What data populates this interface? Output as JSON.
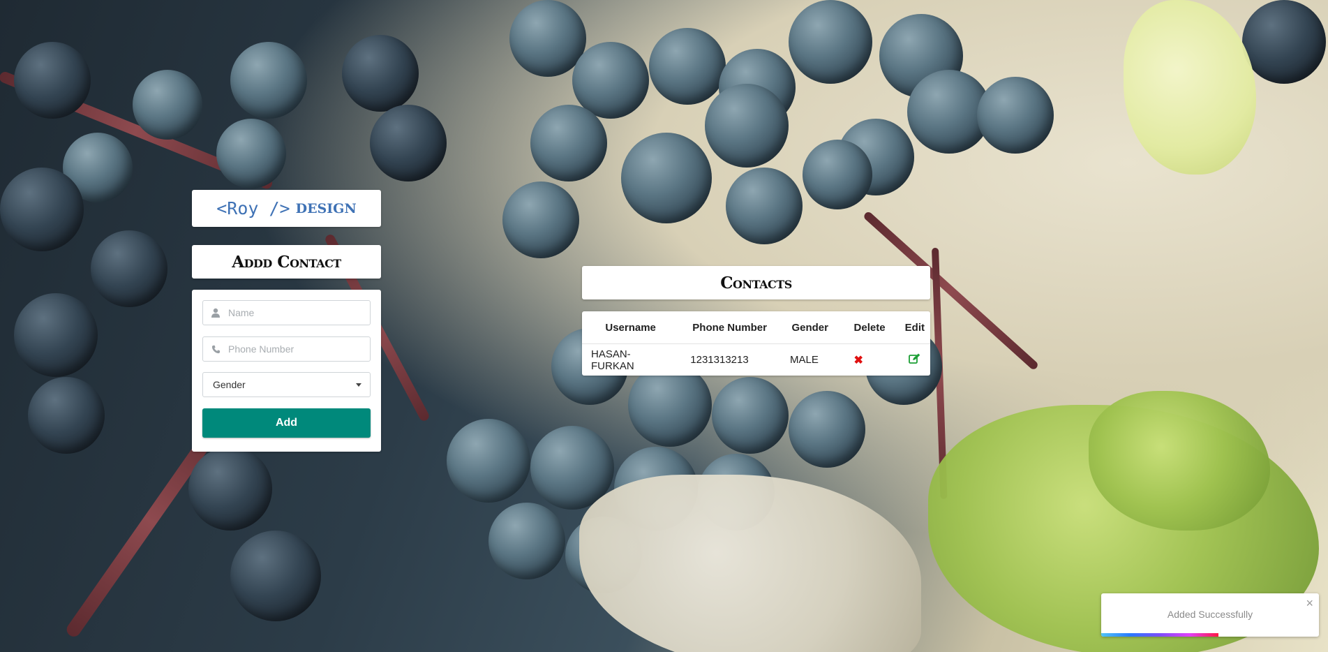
{
  "brand": {
    "code_text": "<Roy />",
    "suffix": "DESIGN",
    "color": "#3f72b5"
  },
  "add_contact": {
    "title": "Addd Contact",
    "name_placeholder": "Name",
    "name_icon": "user-icon",
    "phone_placeholder": "Phone Number",
    "phone_icon": "phone-icon",
    "gender_selected": "Gender",
    "submit_label": "Add",
    "submit_color": "#00897b"
  },
  "contacts": {
    "title": "Contacts",
    "headers": {
      "username": "Username",
      "phone": "Phone Number",
      "gender": "Gender",
      "delete": "Delete",
      "edit": "Edit"
    },
    "rows": [
      {
        "username": "HASAN-FURKAN",
        "phone": "1231313213",
        "gender": "MALE",
        "delete_icon": "delete-x-icon",
        "edit_icon": "edit-icon"
      }
    ],
    "delete_color": "#e01010",
    "edit_color": "#1b9e34"
  },
  "toast": {
    "message": "Added Successfully",
    "close_glyph": "×",
    "progress": 0.54
  }
}
